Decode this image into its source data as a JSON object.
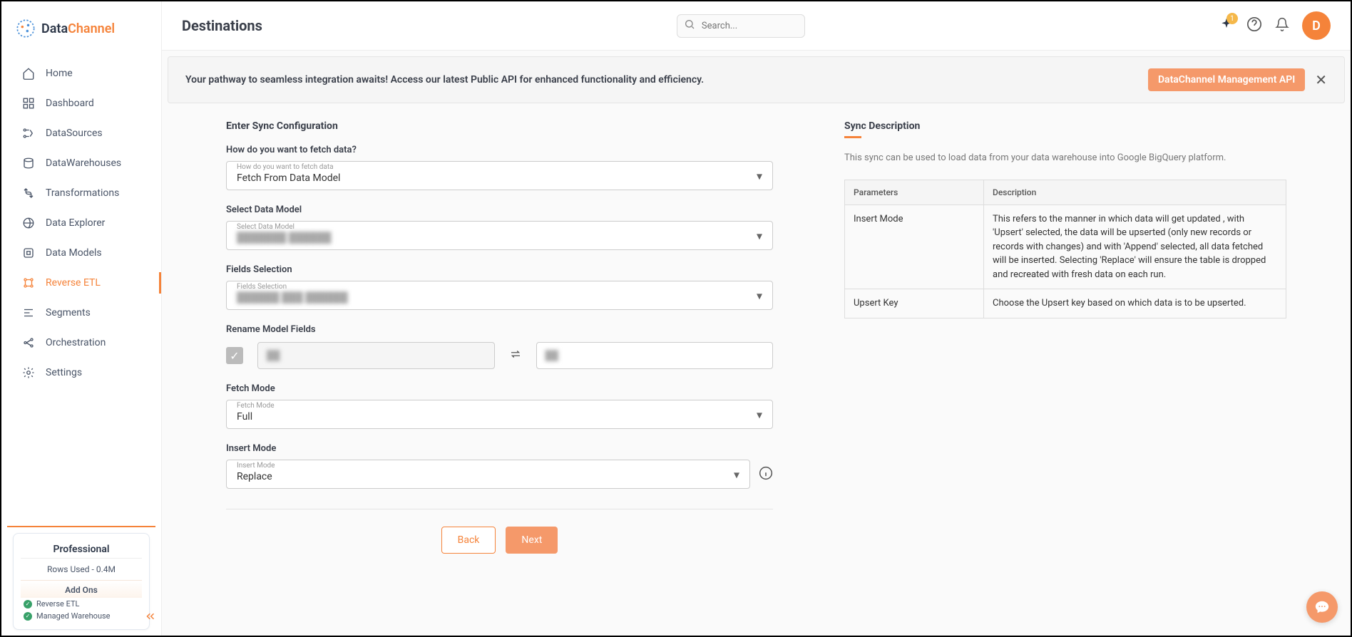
{
  "brand": {
    "name1": "Data",
    "name2": "Channel"
  },
  "nav": {
    "items": [
      {
        "label": "Home"
      },
      {
        "label": "Dashboard"
      },
      {
        "label": "DataSources"
      },
      {
        "label": "DataWarehouses"
      },
      {
        "label": "Transformations"
      },
      {
        "label": "Data Explorer"
      },
      {
        "label": "Data Models"
      },
      {
        "label": "Reverse ETL"
      },
      {
        "label": "Segments"
      },
      {
        "label": "Orchestration"
      },
      {
        "label": "Settings"
      }
    ]
  },
  "plan": {
    "name": "Professional",
    "rows": "Rows Used - 0.4M",
    "addons_title": "Add Ons",
    "addons": [
      {
        "label": "Reverse ETL"
      },
      {
        "label": "Managed Warehouse"
      }
    ]
  },
  "header": {
    "title": "Destinations",
    "search_placeholder": "Search...",
    "badge": "1",
    "avatar": "D"
  },
  "banner": {
    "text": "Your pathway to seamless integration awaits! Access our latest Public API for enhanced functionality and efficiency.",
    "button": "DataChannel Management API"
  },
  "form": {
    "section_title": "Enter Sync Configuration",
    "fetch_question": "How do you want to fetch data?",
    "fetch_floating": "How do you want to fetch data",
    "fetch_value": "Fetch From Data Model",
    "model_label": "Select Data Model",
    "model_floating": "Select Data Model",
    "model_value": "███████ ██████",
    "fields_label": "Fields Selection",
    "fields_floating": "Fields Selection",
    "fields_value": "██████ ███ ██████",
    "rename_label": "Rename Model Fields",
    "rename_src": "██",
    "rename_dst": "██",
    "fetch_mode_label": "Fetch Mode",
    "fetch_mode_floating": "Fetch Mode",
    "fetch_mode_value": "Full",
    "insert_mode_label": "Insert Mode",
    "insert_mode_floating": "Insert Mode",
    "insert_mode_value": "Replace",
    "back": "Back",
    "next": "Next"
  },
  "desc": {
    "title": "Sync Description",
    "text": "This sync can be used to load data from your data warehouse into Google BigQuery platform.",
    "th_param": "Parameters",
    "th_desc": "Description",
    "rows": [
      {
        "param": "Insert Mode",
        "desc": "This refers to the manner in which data will get updated , with 'Upsert' selected, the data will be upserted (only new records or records with changes) and with 'Append' selected, all data fetched will be inserted. Selecting 'Replace' will ensure the table is dropped and recreated with fresh data on each run."
      },
      {
        "param": "Upsert Key",
        "desc": "Choose the Upsert key based on which data is to be upserted."
      }
    ]
  }
}
